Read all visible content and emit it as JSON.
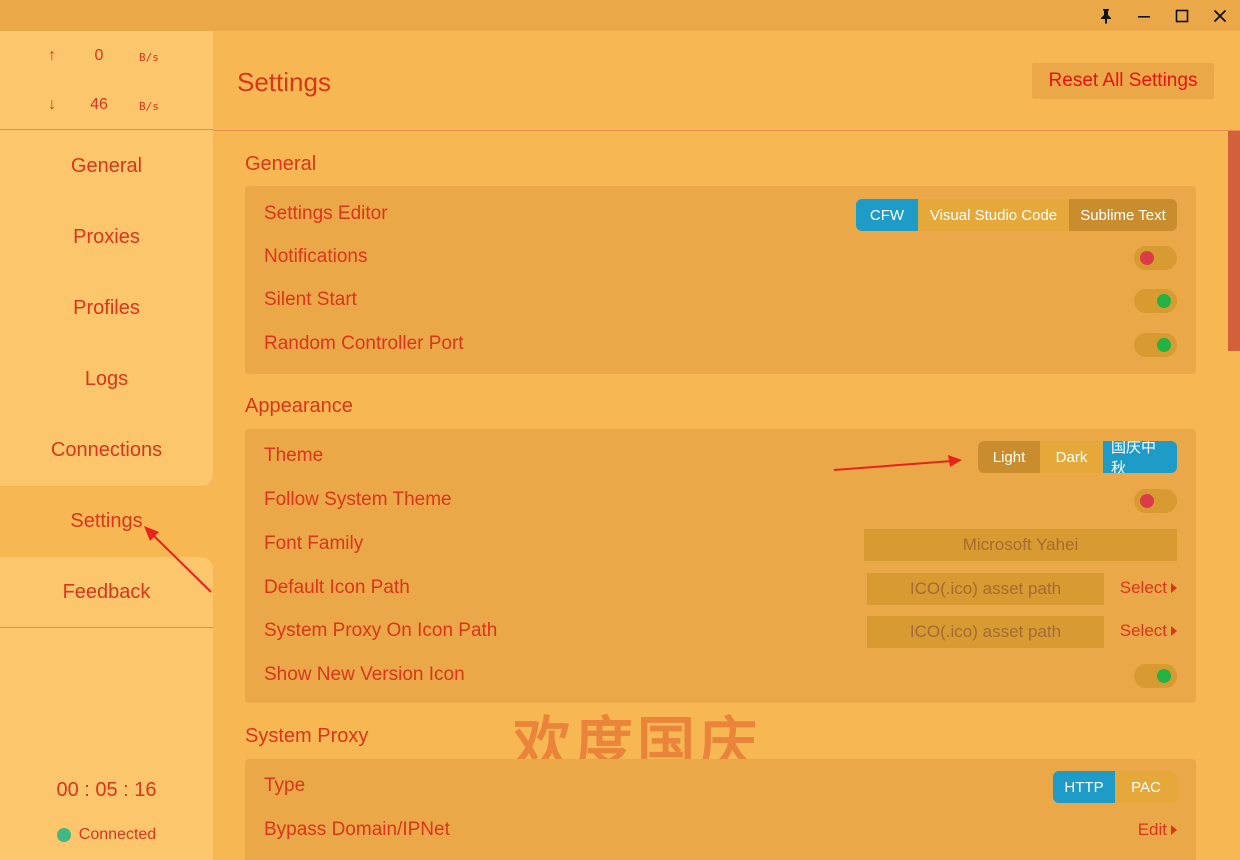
{
  "window": {
    "icons": [
      "pin-icon",
      "minimize-icon",
      "maximize-icon",
      "close-icon"
    ]
  },
  "traffic": {
    "upload": {
      "arrow": "↑",
      "value": "0",
      "unit": "B/s"
    },
    "download": {
      "arrow": "↓",
      "value": "46",
      "unit": "B/s"
    }
  },
  "nav": {
    "items": [
      "General",
      "Proxies",
      "Profiles",
      "Logs",
      "Connections",
      "Settings",
      "Feedback"
    ],
    "active": "Settings"
  },
  "timer": "00 : 05 : 16",
  "status": {
    "label": "Connected",
    "color": "#41b883"
  },
  "header": {
    "title": "Settings",
    "reset_label": "Reset All Settings"
  },
  "general": {
    "title": "General",
    "settings_editor": {
      "label": "Settings Editor",
      "options": [
        "CFW",
        "Visual Studio Code",
        "Sublime Text"
      ],
      "selected": "CFW"
    },
    "notifications": {
      "label": "Notifications",
      "on": false
    },
    "silent_start": {
      "label": "Silent Start",
      "on": true
    },
    "random_controller_port": {
      "label": "Random Controller Port",
      "on": true
    }
  },
  "appearance": {
    "title": "Appearance",
    "theme": {
      "label": "Theme",
      "options": [
        "Light",
        "Dark",
        "国庆中秋"
      ],
      "selected": "国庆中秋"
    },
    "follow_system_theme": {
      "label": "Follow System Theme",
      "on": false
    },
    "font_family": {
      "label": "Font Family",
      "value": "Microsoft Yahei"
    },
    "default_icon_path": {
      "label": "Default Icon Path",
      "placeholder": "ICO(.ico) asset path",
      "action": "Select"
    },
    "system_proxy_icon_path": {
      "label": "System Proxy On Icon Path",
      "placeholder": "ICO(.ico) asset path",
      "action": "Select"
    },
    "show_new_version_icon": {
      "label": "Show New Version Icon",
      "on": true
    }
  },
  "system_proxy": {
    "title": "System Proxy",
    "type": {
      "label": "Type",
      "options": [
        "HTTP",
        "PAC"
      ],
      "selected": "HTTP"
    },
    "bypass": {
      "label": "Bypass Domain/IPNet",
      "action": "Edit"
    }
  },
  "decoration": {
    "festival_text": "欢度国庆"
  },
  "colors": {
    "accent": "#1e9cc7",
    "text": "#d9361c",
    "toggle_on": "#22b344",
    "toggle_off": "#dc3c48",
    "background": "#f7b853"
  }
}
